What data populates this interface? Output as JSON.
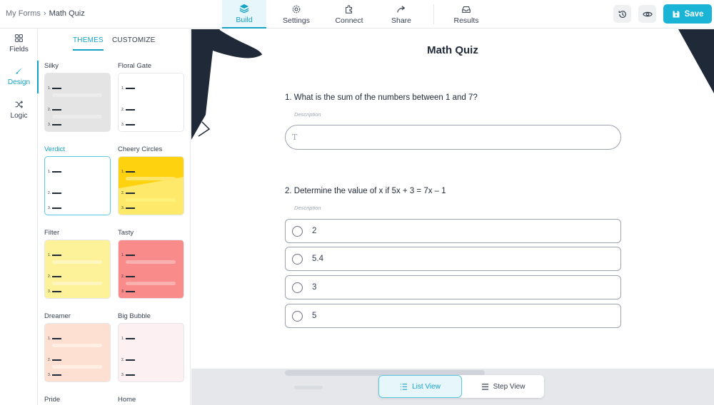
{
  "breadcrumb": {
    "parent": "My Forms",
    "separator": "›",
    "current": "Math Quiz"
  },
  "nav": {
    "build": "Build",
    "settings": "Settings",
    "connect": "Connect",
    "share": "Share",
    "results": "Results",
    "active": "Build"
  },
  "actions": {
    "save_label": "Save"
  },
  "rail": {
    "fields": "Fields",
    "design": "Design",
    "logic": "Logic",
    "active": "Design"
  },
  "panel": {
    "tab_themes": "THEMES",
    "tab_customize": "CUSTOMIZE",
    "active_tab": "THEMES",
    "selected_theme": "Verdict",
    "themes": [
      {
        "name": "Silky"
      },
      {
        "name": "Floral Gate"
      },
      {
        "name": "Verdict"
      },
      {
        "name": "Cheery Circles"
      },
      {
        "name": "Filter"
      },
      {
        "name": "Tasty"
      },
      {
        "name": "Dreamer"
      },
      {
        "name": "Big Bubble"
      },
      {
        "name": "Pride"
      },
      {
        "name": "Home"
      }
    ],
    "card_numbers": [
      "1.",
      "2.",
      "3."
    ]
  },
  "form": {
    "title": "Math Quiz",
    "q1": {
      "title": "1. What is the sum of the numbers between 1 and 7?",
      "description": "Description",
      "input_icon": "T"
    },
    "q2": {
      "title": "2. Determine the value of x if 5x + 3 = 7x – 1",
      "description": "Description",
      "options": [
        "2",
        "5.4",
        "3",
        "5"
      ]
    }
  },
  "view_toggle": {
    "list": "List View",
    "step": "Step View",
    "active": "List View"
  },
  "colors": {
    "accent": "#16a2c4",
    "save": "#19b4d6"
  }
}
